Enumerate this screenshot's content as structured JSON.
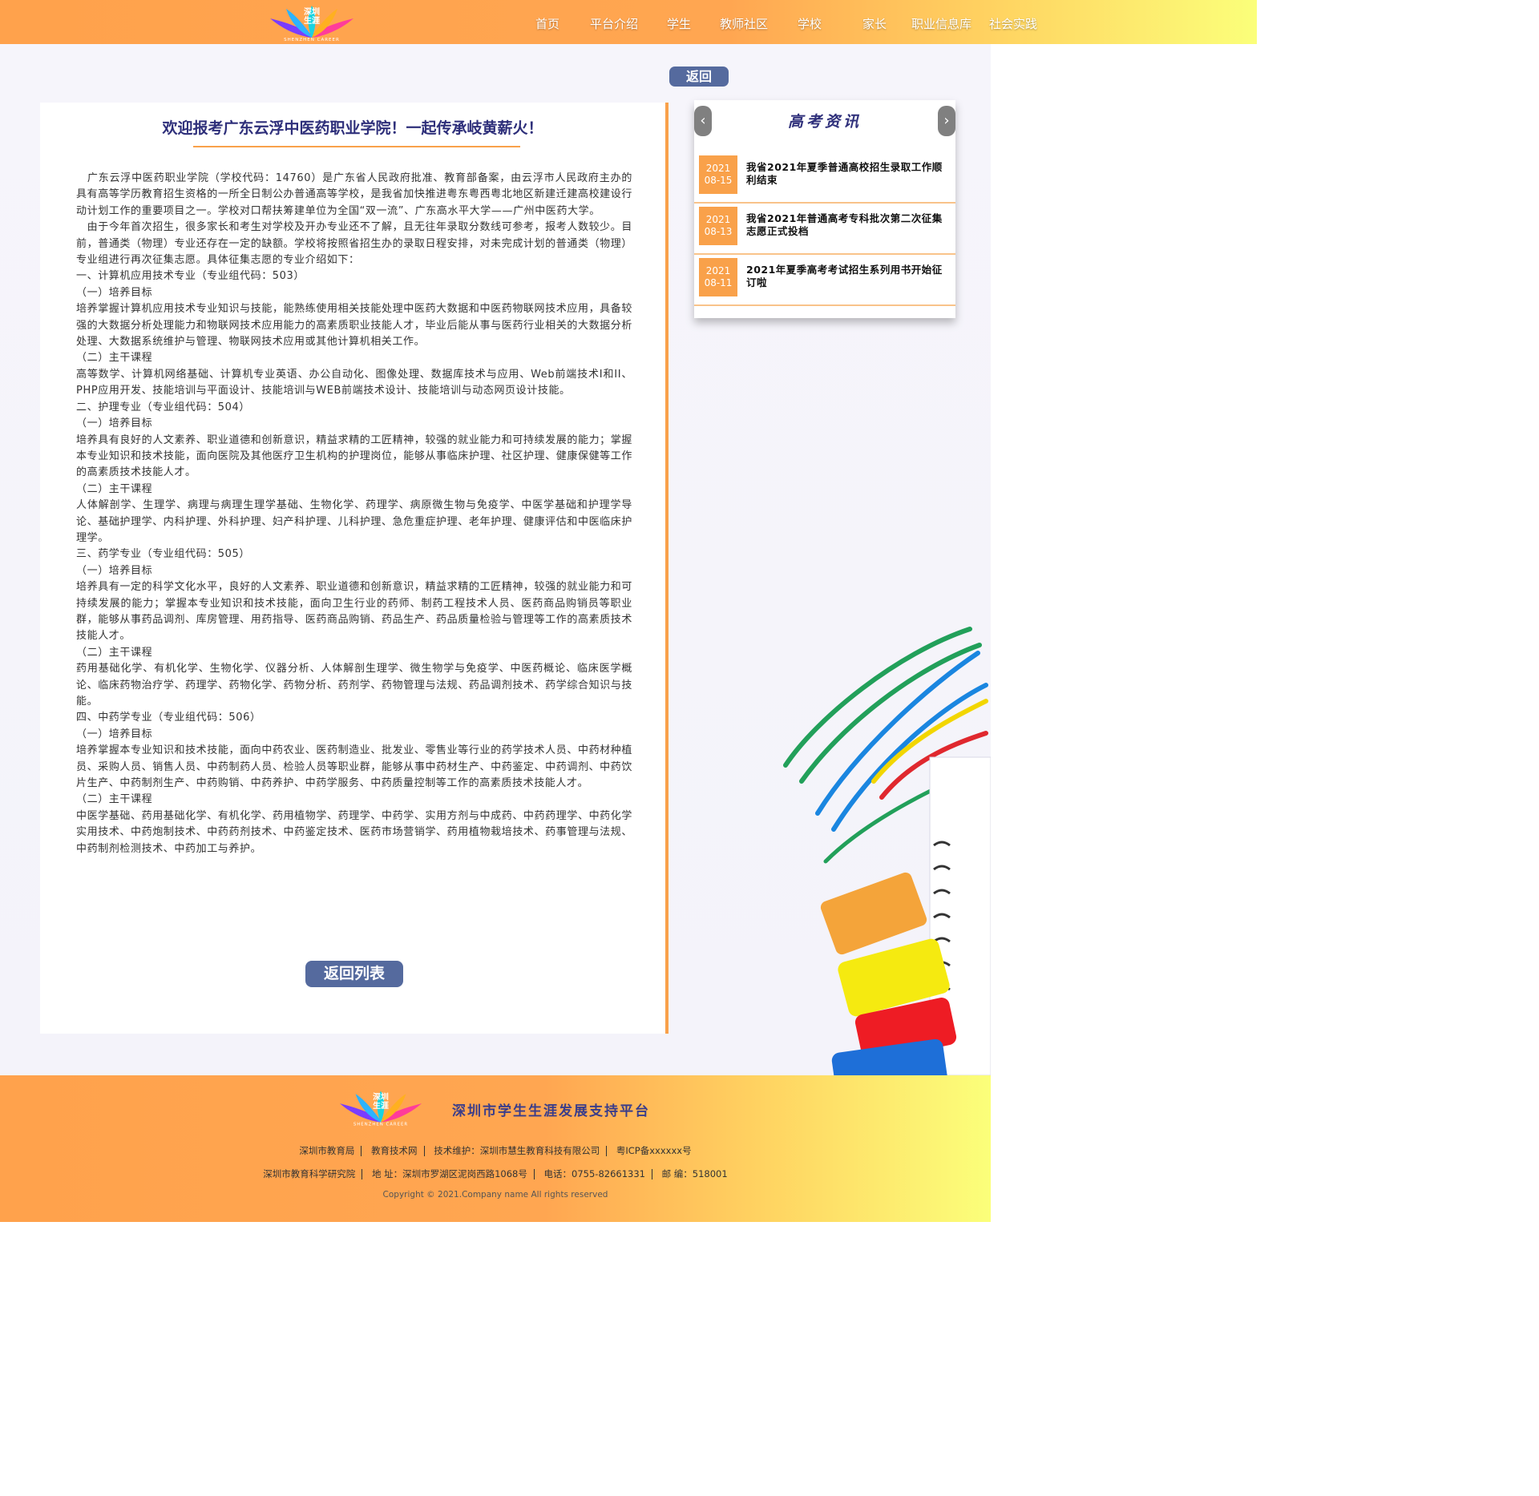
{
  "header": {
    "logo_text_top": "深圳",
    "logo_text_bottom": "生涯",
    "logo_caption": "SHENZHEN CAREER",
    "nav": [
      "首页",
      "平台介绍",
      "学生",
      "教师社区",
      "学校",
      "家长",
      "职业信息库",
      "社会实践"
    ]
  },
  "back_button": "返回",
  "article": {
    "title": "欢迎报考广东云浮中医药职业学院！一起传承岐黄薪火！",
    "paragraphs": [
      "　广东云浮中医药职业学院（学校代码：14760）是广东省人民政府批准、教育部备案，由云浮市人民政府主办的具有高等学历教育招生资格的一所全日制公办普通高等学校，是我省加快推进粤东粤西粤北地区新建迁建高校建设行动计划工作的重要项目之一。学校对口帮扶筹建单位为全国“双一流”、广东高水平大学——广州中医药大学。",
      "　由于今年首次招生，很多家长和考生对学校及开办专业还不了解，且无往年录取分数线可参考，报考人数较少。目前，普通类（物理）专业还存在一定的缺额。学校将按照省招生办的录取日程安排，对未完成计划的普通类（物理）专业组进行再次征集志愿。具体征集志愿的专业介绍如下：",
      "一、计算机应用技术专业（专业组代码：503）",
      "（一）培养目标",
      "培养掌握计算机应用技术专业知识与技能，能熟练使用相关技能处理中医药大数据和中医药物联网技术应用，具备较强的大数据分析处理能力和物联网技术应用能力的高素质职业技能人才，毕业后能从事与医药行业相关的大数据分析处理、大数据系统维护与管理、物联网技术应用或其他计算机相关工作。",
      "（二）主干课程",
      "高等数学、计算机网络基础、计算机专业英语、办公自动化、图像处理、数据库技术与应用、Web前端技术I和II、PHP应用开发、技能培训与平面设计、技能培训与WEB前端技术设计、技能培训与动态网页设计技能。",
      "二、护理专业（专业组代码：504）",
      "（一）培养目标",
      "培养具有良好的人文素养、职业道德和创新意识，精益求精的工匠精神，较强的就业能力和可持续发展的能力；掌握本专业知识和技术技能，面向医院及其他医疗卫生机构的护理岗位，能够从事临床护理、社区护理、健康保健等工作的高素质技术技能人才。",
      "（二）主干课程",
      "人体解剖学、生理学、病理与病理生理学基础、生物化学、药理学、病原微生物与免疫学、中医学基础和护理学导论、基础护理学、内科护理、外科护理、妇产科护理、儿科护理、急危重症护理、老年护理、健康评估和中医临床护理学。",
      "三、药学专业（专业组代码：505）",
      "（一）培养目标",
      "培养具有一定的科学文化水平，良好的人文素养、职业道德和创新意识，精益求精的工匠精神，较强的就业能力和可持续发展的能力；掌握本专业知识和技术技能，面向卫生行业的药师、制药工程技术人员、医药商品购销员等职业群，能够从事药品调剂、库房管理、用药指导、医药商品购销、药品生产、药品质量检验与管理等工作的高素质技术技能人才。",
      "（二）主干课程",
      "药用基础化学、有机化学、生物化学、仪器分析、人体解剖生理学、微生物学与免疫学、中医药概论、临床医学概论、临床药物治疗学、药理学、药物化学、药物分析、药剂学、药物管理与法规、药品调剂技术、药学综合知识与技能。",
      "四、中药学专业（专业组代码：506）",
      "（一）培养目标",
      "培养掌握本专业知识和技术技能，面向中药农业、医药制造业、批发业、零售业等行业的药学技术人员、中药材种植员、采购人员、销售人员、中药制药人员、检验人员等职业群，能够从事中药材生产、中药鉴定、中药调剂、中药饮片生产、中药制剂生产、中药购销、中药养护、中药学服务、中药质量控制等工作的高素质技术技能人才。",
      "（二）主干课程",
      "中医学基础、药用基础化学、有机化学、药用植物学、药理学、中药学、实用方剂与中成药、中药药理学、中药化学实用技术、中药炮制技术、中药药剂技术、中药鉴定技术、医药市场营销学、药用植物栽培技术、药事管理与法规、中药制剂检测技术、中药加工与养护。"
    ],
    "return_list": "返回列表"
  },
  "news": {
    "title": "高考资讯",
    "prev_icon": "‹",
    "next_icon": "›",
    "items": [
      {
        "year": "2021",
        "date": "08-15",
        "text": "我省2021年夏季普通高校招生录取工作顺利结束"
      },
      {
        "year": "2021",
        "date": "08-13",
        "text": "我省2021年普通高考专科批次第二次征集志愿正式投档"
      },
      {
        "year": "2021",
        "date": "08-11",
        "text": "2021年夏季高考考试招生系列用书开始征订啦"
      }
    ]
  },
  "footer": {
    "logo_text_top": "深圳",
    "logo_text_bottom": "生涯",
    "logo_caption": "SHENZHEN CAREER",
    "platform_title": "深圳市学生生涯发展支持平台",
    "line1": [
      "深圳市教育局",
      "教育技术网",
      "技术维护：深圳市慧生教育科技有限公司",
      "粤ICP备xxxxxx号"
    ],
    "line2": [
      "深圳市教育科学研究院",
      "地  址：深圳市罗湖区泥岗西路1068号",
      "电话：0755-82661331",
      "邮  编：518001"
    ],
    "copyright": "Copyright © 2021.Company name All rights reserved"
  },
  "colors": {
    "accent_orange": "#f9a14a",
    "button_blue": "#556a9e",
    "title_navy": "#2e2f7a"
  }
}
